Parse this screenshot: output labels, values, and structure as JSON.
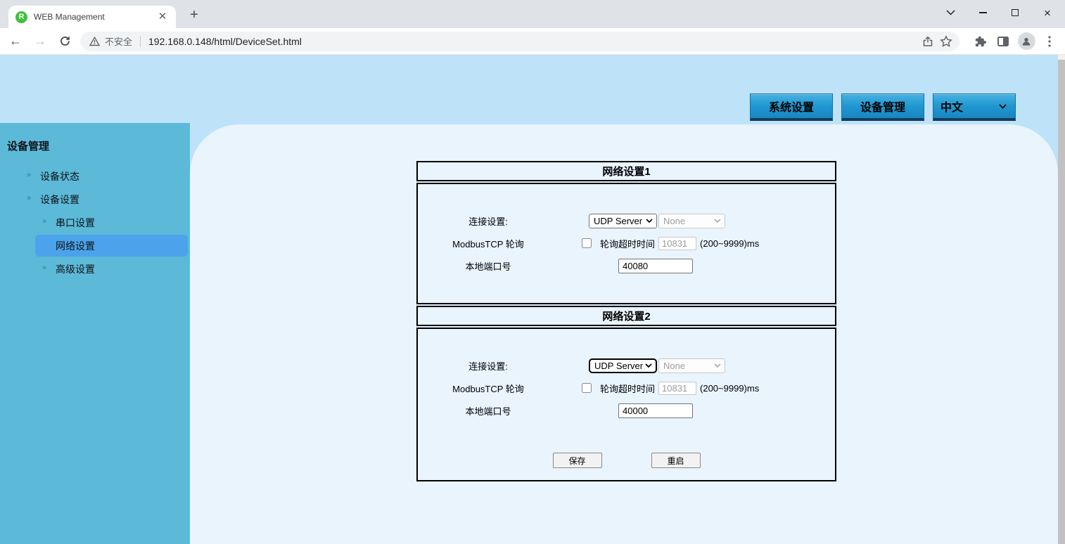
{
  "browser": {
    "tab": {
      "title": "WEB Management",
      "favicon_letter": "R"
    },
    "address": {
      "security_label": "不安全",
      "url": "192.168.0.148/html/DeviceSet.html"
    }
  },
  "topnav": {
    "system_button": "系统设置",
    "device_button": "设备管理",
    "language_value": "中文"
  },
  "sidebar": {
    "title": "设备管理",
    "items": [
      {
        "label": "设备状态",
        "level": 1,
        "selected": false
      },
      {
        "label": "设备设置",
        "level": 1,
        "selected": false
      },
      {
        "label": "串口设置",
        "level": 2,
        "selected": false
      },
      {
        "label": "网络设置",
        "level": 2,
        "selected": true
      },
      {
        "label": "高级设置",
        "level": 2,
        "selected": false
      }
    ]
  },
  "panels": [
    {
      "title": "网络设置1",
      "connection_label": "连接设置:",
      "connection_value": "UDP Server",
      "secondary_value": "None",
      "modbus_label": "ModbusTCP 轮询",
      "modbus_checked": false,
      "timeout_label": "轮询超时时间",
      "timeout_value": "10831",
      "timeout_range": "(200~9999)ms",
      "port_label": "本地端口号",
      "port_value": "40080"
    },
    {
      "title": "网络设置2",
      "connection_label": "连接设置:",
      "connection_value": "UDP Server",
      "secondary_value": "None",
      "modbus_label": "ModbusTCP 轮询",
      "modbus_checked": false,
      "timeout_label": "轮询超时时间",
      "timeout_value": "10831",
      "timeout_range": "(200~9999)ms",
      "port_label": "本地端口号",
      "port_value": "40000"
    }
  ],
  "actions": {
    "save": "保存",
    "restart": "重启"
  },
  "colors": {
    "header_band": "#bee2f8",
    "sidebar": "#5cb9d8",
    "selected_item": "#4aa3eb",
    "content": "#e9f4fd",
    "nav_button": "#2097d0"
  }
}
